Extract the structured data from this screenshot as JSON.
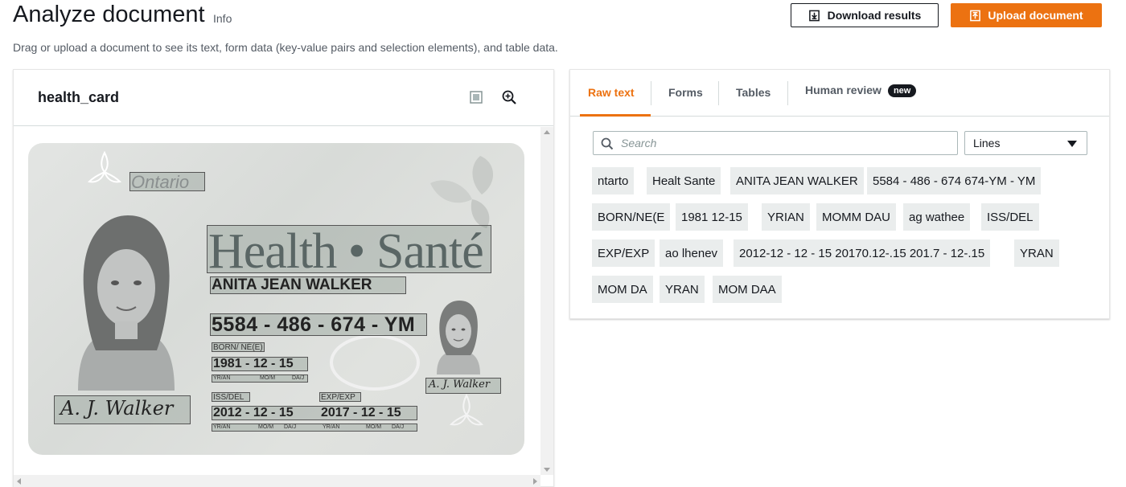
{
  "header": {
    "title": "Analyze document",
    "info_link": "Info",
    "subtitle": "Drag or upload a document to see its text, form data (key-value pairs and selection elements), and table data.",
    "download_label": "Download results",
    "upload_label": "Upload document"
  },
  "document": {
    "name": "health_card",
    "card": {
      "province": "Ontario",
      "heading": "Health • Santé",
      "holder_name": "ANITA JEAN WALKER",
      "health_number": "5584 - 486 - 674 - YM",
      "born_label": "BORN/ NÉ(E)",
      "birth_date": "1981 - 12 - 15",
      "iss_label": "ISS/DÉL",
      "exp_label": "EXP/EXP",
      "issue_date": "2012 - 12 - 15",
      "expiry_date": "2017 - 12 - 15",
      "date_format_1": "YR/AN",
      "date_format_2": "MO/M",
      "date_format_3": "DA/J",
      "signature": "A. J. Walker"
    }
  },
  "results": {
    "tabs": [
      {
        "label": "Raw text",
        "active": true
      },
      {
        "label": "Forms",
        "active": false
      },
      {
        "label": "Tables",
        "active": false
      },
      {
        "label": "Human review",
        "active": false,
        "badge": "new"
      }
    ],
    "search_placeholder": "Search",
    "search_value": "",
    "view_select": "Lines",
    "lines": [
      "ntarto",
      "Healt Sante",
      "ANITA JEAN WALKER",
      "5584 - 486 - 674 674-YM - YM",
      "BORN/NE(E",
      "1981 12-15",
      "YRIAN",
      "MOMM DAU",
      "ag wathee",
      "ISS/DEL",
      "EXP/EXP",
      "ao lhenev",
      "2012-12 - 12 - 15 20170.12-.15 201.7 - 12-.15",
      "YRAN",
      "MOM DA",
      "YRAN",
      "MOM DAA"
    ]
  },
  "colors": {
    "accent": "#ec7211",
    "text": "#16191f",
    "muted": "#545b64",
    "chip_bg": "#eaeded"
  }
}
